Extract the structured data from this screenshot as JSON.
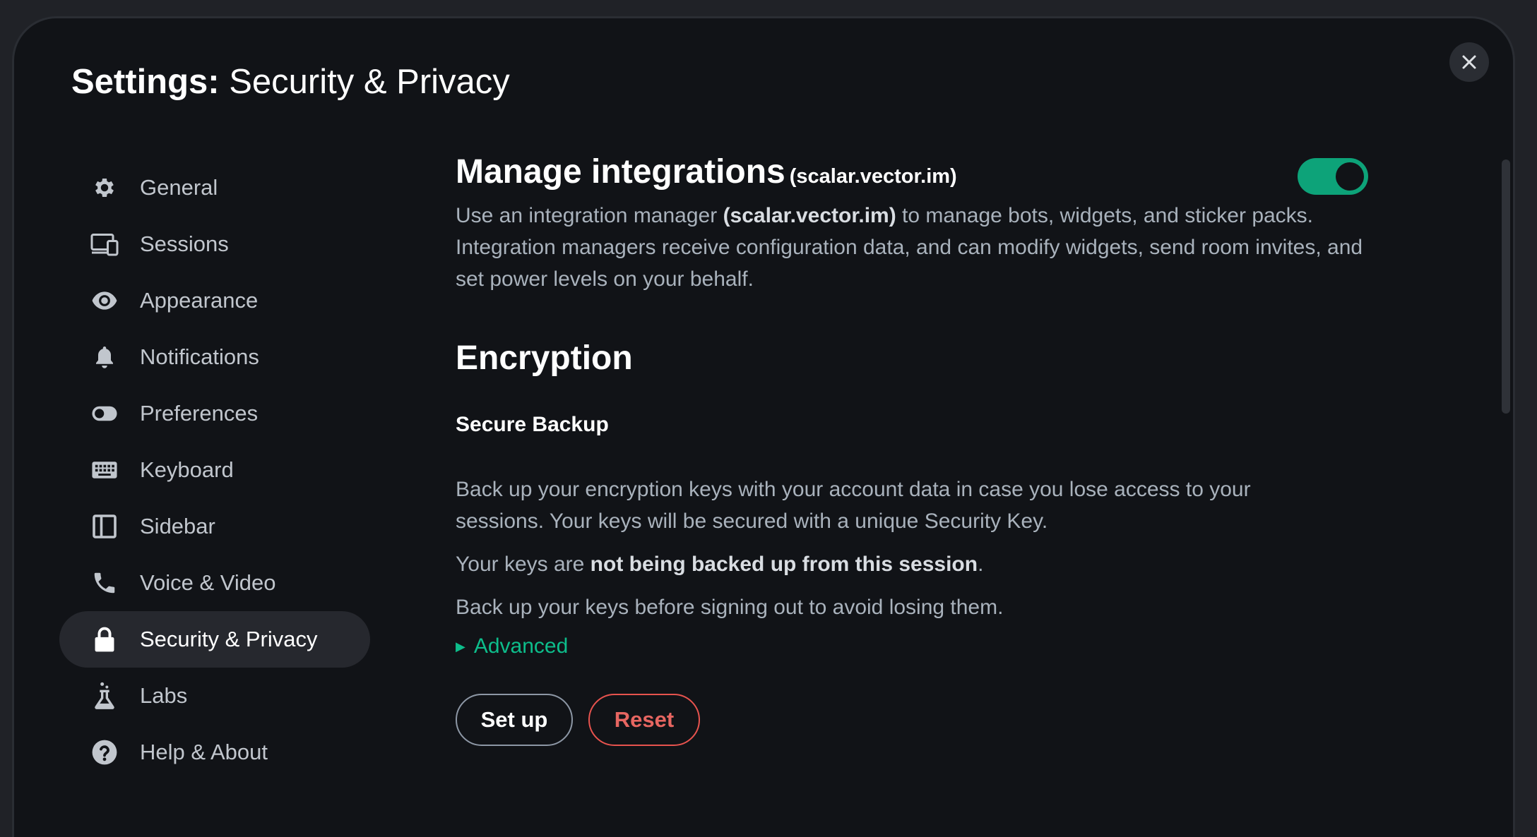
{
  "dialog": {
    "title_bold": "Settings:",
    "title_rest": " Security & Privacy",
    "close_icon": "close-icon"
  },
  "sidebar": {
    "items": [
      {
        "label": "General",
        "icon": "gear-icon"
      },
      {
        "label": "Sessions",
        "icon": "devices-icon"
      },
      {
        "label": "Appearance",
        "icon": "eye-icon"
      },
      {
        "label": "Notifications",
        "icon": "bell-icon"
      },
      {
        "label": "Preferences",
        "icon": "toggle-icon"
      },
      {
        "label": "Keyboard",
        "icon": "keyboard-icon"
      },
      {
        "label": "Sidebar",
        "icon": "sidebar-icon"
      },
      {
        "label": "Voice & Video",
        "icon": "phone-icon"
      },
      {
        "label": "Security & Privacy",
        "icon": "lock-icon",
        "active": true
      },
      {
        "label": "Labs",
        "icon": "flask-icon"
      },
      {
        "label": "Help & About",
        "icon": "help-icon"
      }
    ]
  },
  "integrations": {
    "heading": "Manage integrations",
    "heading_sub": "(scalar.vector.im)",
    "toggle_on": true,
    "desc_pre": "Use an integration manager ",
    "desc_bold": "(scalar.vector.im)",
    "desc_post": " to manage bots, widgets, and sticker packs. Integration managers receive configuration data, and can modify widgets, send room invites, and set power levels on your behalf."
  },
  "encryption": {
    "heading": "Encryption",
    "backup_heading": "Secure Backup",
    "backup_desc": "Back up your encryption keys with your account data in case you lose access to your sessions. Your keys will be secured with a unique Security Key.",
    "status_pre": "Your keys are ",
    "status_bold": "not being backed up from this session",
    "status_post": ".",
    "advice": "Back up your keys before signing out to avoid losing them.",
    "advanced_label": "Advanced",
    "setup_label": "Set up",
    "reset_label": "Reset"
  },
  "colors": {
    "accent": "#0dbd8b",
    "danger": "#ff5b55",
    "background": "#111317"
  }
}
